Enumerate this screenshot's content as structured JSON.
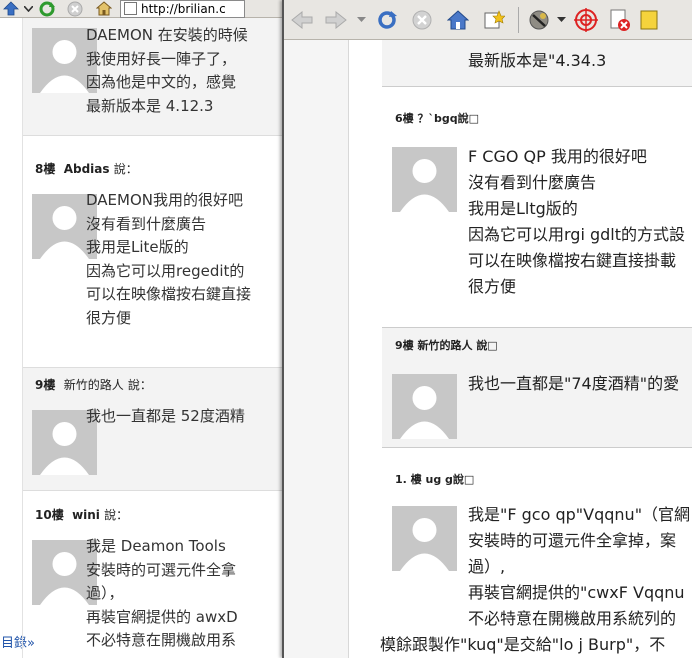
{
  "left_window": {
    "url": "http://brilian.c",
    "bottom_link": "目錄»",
    "top_comment_lines": [
      "DAEMON 在安裝的時候",
      "我使用好長一陣子了，",
      "因為他是中文的，感覺",
      "最新版本是 4.12.3"
    ],
    "comments": [
      {
        "floor": "8樓",
        "author": "Abdias",
        "says": "說：",
        "lines": [
          "DAEMON我用的很好吧",
          "沒有看到什麼廣告",
          "我用是Lite版的",
          "因為它可以用regedit的",
          "可以在映像檔按右鍵直接",
          "很方便"
        ]
      },
      {
        "floor": "9樓",
        "author": "新竹的路人",
        "says": "說：",
        "lines": [
          "我也一直都是 52度酒精"
        ]
      },
      {
        "floor": "10樓",
        "author": "wini",
        "says": "說：",
        "lines": [
          "我是 Deamon Tools",
          "安裝時的可選元件全拿",
          "過），",
          "再裝官網提供的 awxD",
          "不必特意在開機啟用系"
        ]
      }
    ]
  },
  "right_window": {
    "top_line": "最新版本是\"4.34.3",
    "comments": [
      {
        "header": "6樓 ？`bgq說□",
        "lines": [
          "F CGO QP 我用的很好吧",
          "沒有看到什麼廣告",
          "我用是Lltg版的",
          "因為它可以用rgi gdlt的方式設",
          "可以在映像檔按右鍵直接掛載",
          "很方便"
        ]
      },
      {
        "header": "9樓 新竹的路人 說□",
        "lines": [
          "我也一直都是\"74度酒精\"的愛"
        ]
      },
      {
        "header": "1. 樓 ug g說□",
        "lines": [
          "我是\"F gco qp\"Vqqnu\"（官網",
          "安裝時的可還元件全拿掉，案",
          "過）,",
          "再裝官網提供的\"cwxF Vqqnu",
          "不必特意在開機啟用系統列的"
        ]
      }
    ],
    "bottom_line": "模餘跟製作\"kuq\"是交給\"lo j Burp\"，不"
  }
}
